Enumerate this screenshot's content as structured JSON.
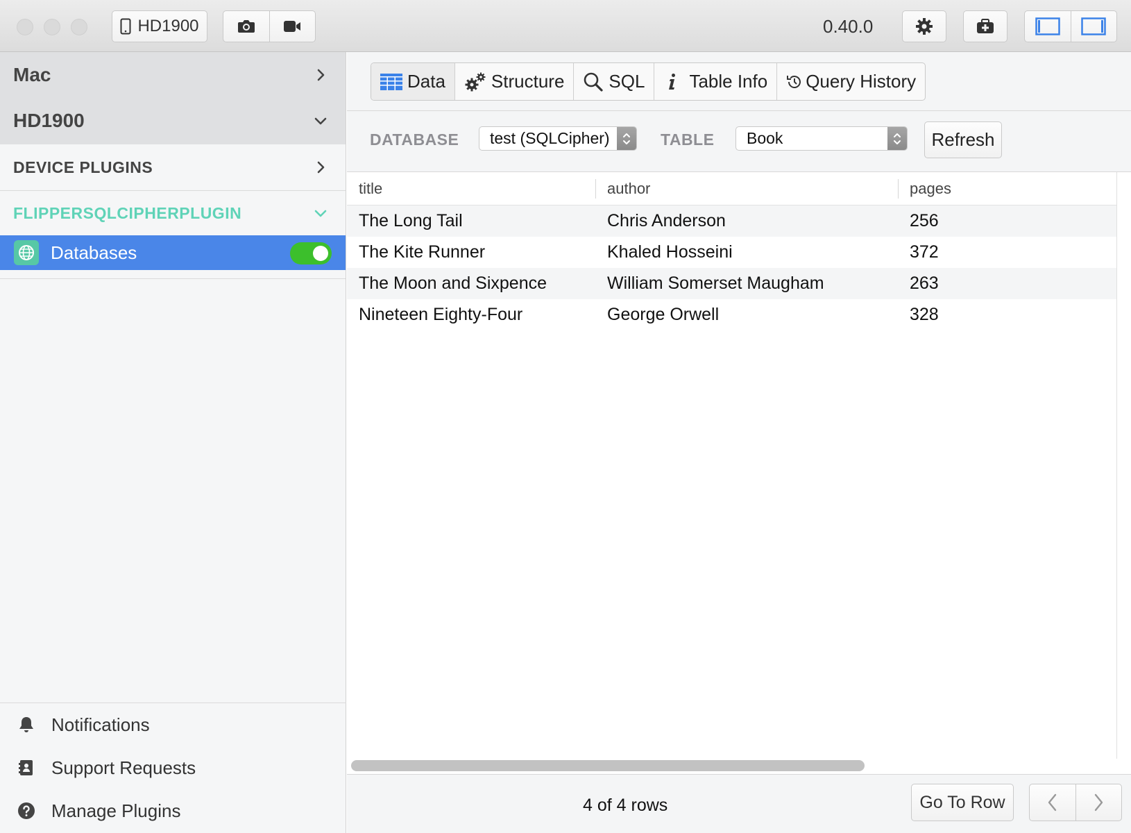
{
  "titlebar": {
    "device_button_label": "HD1900",
    "version": "0.40.0"
  },
  "sidebar": {
    "sections": {
      "mac_label": "Mac",
      "device_label": "HD1900",
      "device_plugins_label": "DEVICE PLUGINS",
      "plugin_group_label": "FLIPPERSQLCIPHERPLUGIN"
    },
    "active_plugin": {
      "label": "Databases",
      "enabled": true
    },
    "bottom_items": [
      {
        "label": "Notifications",
        "icon": "bell-icon"
      },
      {
        "label": "Support Requests",
        "icon": "clipboard-icon"
      },
      {
        "label": "Manage Plugins",
        "icon": "question-icon"
      }
    ]
  },
  "tabs": [
    {
      "label": "Data",
      "icon": "grid-icon",
      "active": true
    },
    {
      "label": "Structure",
      "icon": "gears-icon"
    },
    {
      "label": "SQL",
      "icon": "search-icon"
    },
    {
      "label": "Table Info",
      "icon": "info-icon"
    },
    {
      "label": "Query History",
      "icon": "history-icon"
    }
  ],
  "toolbar": {
    "database_label": "DATABASE",
    "database_value": "test (SQLCipher)",
    "table_label": "TABLE",
    "table_value": "Book",
    "refresh_label": "Refresh"
  },
  "table": {
    "columns": [
      "title",
      "author",
      "pages"
    ],
    "rows": [
      [
        "The Long Tail",
        "Chris Anderson",
        "256"
      ],
      [
        "The Kite Runner",
        "Khaled Hosseini",
        "372"
      ],
      [
        "The Moon and Sixpence",
        "William Somerset Maugham",
        "263"
      ],
      [
        "Nineteen Eighty-Four",
        "George Orwell",
        "328"
      ]
    ]
  },
  "footer": {
    "row_count": "4 of 4 rows",
    "goto_label": "Go To Row"
  },
  "colors": {
    "accent": "#4a86e8",
    "plugin_group": "#5fd3b7",
    "toggle_on": "#3cbf2c"
  }
}
